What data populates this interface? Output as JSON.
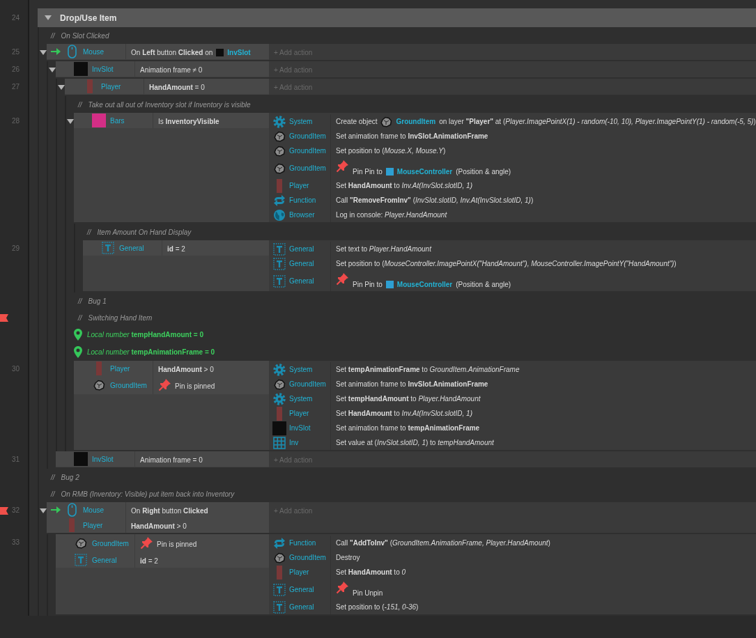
{
  "group": {
    "line": "24",
    "title": "Drop/Use Item",
    "expanded": true,
    "children": [
      {
        "kind": "comment",
        "bookmarked": false,
        "marker": "//",
        "text": "On Slot Clicked"
      },
      {
        "kind": "event",
        "line": "25",
        "bookmarked": false,
        "expanded": true,
        "conditions": [
          {
            "trigger": true,
            "object": {
              "name": "Mouse",
              "kind": "mouse"
            },
            "segments": [
              {
                "kind": "text",
                "text": "On **Left** button **Clicked** on"
              },
              {
                "kind": "object",
                "object": {
                  "name": "InvSlot",
                  "kind": "sprite-square",
                  "color": "#0d0d0d"
                }
              }
            ]
          }
        ],
        "add_action": "+ Add action",
        "children": [
          {
            "kind": "event",
            "line": "26",
            "bookmarked": false,
            "expanded": true,
            "conditions": [
              {
                "trigger": false,
                "object": {
                  "name": "InvSlot",
                  "kind": "sprite-square",
                  "color": "#0d0d0d"
                },
                "segments": [
                  {
                    "kind": "text",
                    "text": "Animation frame ≠ 0"
                  }
                ]
              }
            ],
            "add_action": "+ Add action",
            "children": [
              {
                "kind": "event",
                "line": "27",
                "bookmarked": false,
                "expanded": true,
                "conditions": [
                  {
                    "trigger": false,
                    "object": {
                      "name": "Player",
                      "kind": "sprite-bar",
                      "color": "#7a3838"
                    },
                    "segments": [
                      {
                        "kind": "text",
                        "text": "**HandAmount** = 0"
                      }
                    ]
                  }
                ],
                "add_action": "+ Add action",
                "children": [
                  {
                    "kind": "comment",
                    "bookmarked": false,
                    "marker": "//",
                    "text": "Take out all out of Inventory slot if Inventory is visible"
                  },
                  {
                    "kind": "event",
                    "line": "28",
                    "bookmarked": false,
                    "expanded": true,
                    "conditions": [
                      {
                        "trigger": false,
                        "object": {
                          "name": "Bars",
                          "kind": "sprite-square",
                          "color": "#d42e86"
                        },
                        "segments": [
                          {
                            "kind": "text",
                            "text": "Is **InventoryVisible**"
                          }
                        ]
                      }
                    ],
                    "actions": [
                      {
                        "object": {
                          "name": "System",
                          "kind": "system"
                        },
                        "segments": [
                          {
                            "kind": "text",
                            "text": "Create object"
                          },
                          {
                            "kind": "object",
                            "object": {
                              "name": "GroundItem",
                              "kind": "rock"
                            }
                          },
                          {
                            "kind": "text",
                            "text": "on layer **\"Player\"** at (*Player.ImagePointX(1) - random(-10, 10), Player.ImagePointY(1) - random(-5, 5)*)"
                          }
                        ]
                      },
                      {
                        "object": {
                          "name": "GroundItem",
                          "kind": "rock"
                        },
                        "segments": [
                          {
                            "kind": "text",
                            "text": "Set animation frame to **InvSlot.AnimationFrame**"
                          }
                        ]
                      },
                      {
                        "object": {
                          "name": "GroundItem",
                          "kind": "rock"
                        },
                        "segments": [
                          {
                            "kind": "text",
                            "text": "Set position to (*Mouse.X, Mouse.Y*)"
                          }
                        ]
                      },
                      {
                        "object": {
                          "name": "GroundItem",
                          "kind": "rock"
                        },
                        "segments": [
                          {
                            "kind": "pin"
                          },
                          {
                            "kind": "text",
                            "text": "Pin Pin to"
                          },
                          {
                            "kind": "object",
                            "object": {
                              "name": "MouseController",
                              "kind": "sprite-square",
                              "color": "#2e9fd2"
                            }
                          },
                          {
                            "kind": "text",
                            "text": "(Position & angle)"
                          }
                        ]
                      },
                      {
                        "object": {
                          "name": "Player",
                          "kind": "sprite-bar",
                          "color": "#7a3838"
                        },
                        "segments": [
                          {
                            "kind": "text",
                            "text": "Set **HandAmount** to *Inv.At(InvSlot.slotID, 1)*"
                          }
                        ]
                      },
                      {
                        "object": {
                          "name": "Function",
                          "kind": "function"
                        },
                        "segments": [
                          {
                            "kind": "text",
                            "text": "Call **\"RemoveFromInv\"** (*InvSlot.slotID, Inv.At(InvSlot.slotID, 1)*)"
                          }
                        ]
                      },
                      {
                        "object": {
                          "name": "Browser",
                          "kind": "browser"
                        },
                        "segments": [
                          {
                            "kind": "text",
                            "text": "Log in console: *Player.HandAmount*"
                          }
                        ]
                      }
                    ],
                    "children": [
                      {
                        "kind": "comment",
                        "bookmarked": false,
                        "marker": "//",
                        "text": "Item Amount On Hand Display"
                      },
                      {
                        "kind": "event",
                        "line": "29",
                        "bookmarked": false,
                        "conditions": [
                          {
                            "trigger": false,
                            "object": {
                              "name": "General",
                              "kind": "text-object"
                            },
                            "segments": [
                              {
                                "kind": "text",
                                "text": "**id** = 2"
                              }
                            ]
                          }
                        ],
                        "actions": [
                          {
                            "object": {
                              "name": "General",
                              "kind": "text-object"
                            },
                            "segments": [
                              {
                                "kind": "text",
                                "text": "Set text to *Player.HandAmount*"
                              }
                            ]
                          },
                          {
                            "object": {
                              "name": "General",
                              "kind": "text-object"
                            },
                            "segments": [
                              {
                                "kind": "text",
                                "text": "Set position to (*MouseController.ImagePointX(\"HandAmount\"), MouseController.ImagePointY(\"HandAmount\")*)"
                              }
                            ]
                          },
                          {
                            "object": {
                              "name": "General",
                              "kind": "text-object"
                            },
                            "segments": [
                              {
                                "kind": "pin"
                              },
                              {
                                "kind": "text",
                                "text": "Pin Pin to"
                              },
                              {
                                "kind": "object",
                                "object": {
                                  "name": "MouseController",
                                  "kind": "sprite-square",
                                  "color": "#2e9fd2"
                                }
                              },
                              {
                                "kind": "text",
                                "text": "(Position & angle)"
                              }
                            ]
                          }
                        ]
                      }
                    ]
                  },
                  {
                    "kind": "comment",
                    "bookmarked": false,
                    "marker": "//",
                    "text": "Bug 1"
                  },
                  {
                    "kind": "comment",
                    "bookmarked": true,
                    "marker": "//",
                    "text": "Switching Hand Item"
                  },
                  {
                    "kind": "variable",
                    "bookmarked": false,
                    "text": "*Local number* **tempHandAmount = 0**"
                  },
                  {
                    "kind": "variable",
                    "bookmarked": false,
                    "text": "*Local number* **tempAnimationFrame = 0**"
                  },
                  {
                    "kind": "event",
                    "line": "30",
                    "bookmarked": false,
                    "conditions": [
                      {
                        "trigger": false,
                        "object": {
                          "name": "Player",
                          "kind": "sprite-bar",
                          "color": "#7a3838"
                        },
                        "segments": [
                          {
                            "kind": "text",
                            "text": "**HandAmount** > 0"
                          }
                        ]
                      },
                      {
                        "trigger": false,
                        "object": {
                          "name": "GroundItem",
                          "kind": "rock"
                        },
                        "segments": [
                          {
                            "kind": "pin"
                          },
                          {
                            "kind": "text",
                            "text": "Pin is pinned"
                          }
                        ]
                      }
                    ],
                    "actions": [
                      {
                        "object": {
                          "name": "System",
                          "kind": "system"
                        },
                        "segments": [
                          {
                            "kind": "text",
                            "text": "Set **tempAnimationFrame** to *GroundItem.AnimationFrame*"
                          }
                        ]
                      },
                      {
                        "object": {
                          "name": "GroundItem",
                          "kind": "rock"
                        },
                        "segments": [
                          {
                            "kind": "text",
                            "text": "Set animation frame to **InvSlot.AnimationFrame**"
                          }
                        ]
                      },
                      {
                        "object": {
                          "name": "System",
                          "kind": "system"
                        },
                        "segments": [
                          {
                            "kind": "text",
                            "text": "Set **tempHandAmount** to *Player.HandAmount*"
                          }
                        ]
                      },
                      {
                        "object": {
                          "name": "Player",
                          "kind": "sprite-bar",
                          "color": "#7a3838"
                        },
                        "segments": [
                          {
                            "kind": "text",
                            "text": "Set **HandAmount** to *Inv.At(InvSlot.slotID, 1)*"
                          }
                        ]
                      },
                      {
                        "object": {
                          "name": "InvSlot",
                          "kind": "sprite-square",
                          "color": "#0d0d0d"
                        },
                        "segments": [
                          {
                            "kind": "text",
                            "text": "Set animation frame to **tempAnimationFrame**"
                          }
                        ]
                      },
                      {
                        "object": {
                          "name": "Inv",
                          "kind": "array"
                        },
                        "segments": [
                          {
                            "kind": "text",
                            "text": "Set value at (*InvSlot.slotID, 1*) to *tempHandAmount*"
                          }
                        ]
                      }
                    ]
                  }
                ]
              }
            ]
          },
          {
            "kind": "event",
            "line": "31",
            "bookmarked": false,
            "conditions": [
              {
                "trigger": false,
                "object": {
                  "name": "InvSlot",
                  "kind": "sprite-square",
                  "color": "#0d0d0d"
                },
                "segments": [
                  {
                    "kind": "text",
                    "text": "Animation frame = 0"
                  }
                ]
              }
            ],
            "add_action": "+ Add action"
          }
        ]
      },
      {
        "kind": "comment",
        "bookmarked": false,
        "marker": "//",
        "text": "Bug 2"
      },
      {
        "kind": "comment",
        "bookmarked": false,
        "marker": "//",
        "text": "On RMB (Inventory: Visible) put item back into Inventory"
      },
      {
        "kind": "event",
        "line": "32",
        "bookmarked": true,
        "expanded": true,
        "conditions": [
          {
            "trigger": true,
            "object": {
              "name": "Mouse",
              "kind": "mouse"
            },
            "segments": [
              {
                "kind": "text",
                "text": "On **Right** button **Clicked**"
              }
            ]
          },
          {
            "trigger": false,
            "object": {
              "name": "Player",
              "kind": "sprite-bar",
              "color": "#7a3838"
            },
            "segments": [
              {
                "kind": "text",
                "text": "**HandAmount** > 0"
              }
            ]
          }
        ],
        "add_action": "+ Add action",
        "children": [
          {
            "kind": "event",
            "line": "33",
            "bookmarked": false,
            "conditions": [
              {
                "trigger": false,
                "object": {
                  "name": "GroundItem",
                  "kind": "rock"
                },
                "segments": [
                  {
                    "kind": "pin"
                  },
                  {
                    "kind": "text",
                    "text": "Pin is pinned"
                  }
                ]
              },
              {
                "trigger": false,
                "object": {
                  "name": "General",
                  "kind": "text-object"
                },
                "segments": [
                  {
                    "kind": "text",
                    "text": "**id** = 2"
                  }
                ]
              }
            ],
            "actions": [
              {
                "object": {
                  "name": "Function",
                  "kind": "function"
                },
                "segments": [
                  {
                    "kind": "text",
                    "text": "Call **\"AddToInv\"** (*GroundItem.AnimationFrame, Player.HandAmount*)"
                  }
                ]
              },
              {
                "object": {
                  "name": "GroundItem",
                  "kind": "rock"
                },
                "segments": [
                  {
                    "kind": "text",
                    "text": "Destroy"
                  }
                ]
              },
              {
                "object": {
                  "name": "Player",
                  "kind": "sprite-bar",
                  "color": "#7a3838"
                },
                "segments": [
                  {
                    "kind": "text",
                    "text": "Set **HandAmount** to *0*"
                  }
                ]
              },
              {
                "object": {
                  "name": "General",
                  "kind": "text-object"
                },
                "segments": [
                  {
                    "kind": "pin"
                  },
                  {
                    "kind": "text",
                    "text": "Pin Unpin"
                  }
                ]
              },
              {
                "object": {
                  "name": "General",
                  "kind": "text-object"
                },
                "segments": [
                  {
                    "kind": "text",
                    "text": "Set position to (*-151, 0-36*)"
                  }
                ]
              }
            ]
          }
        ]
      }
    ]
  }
}
